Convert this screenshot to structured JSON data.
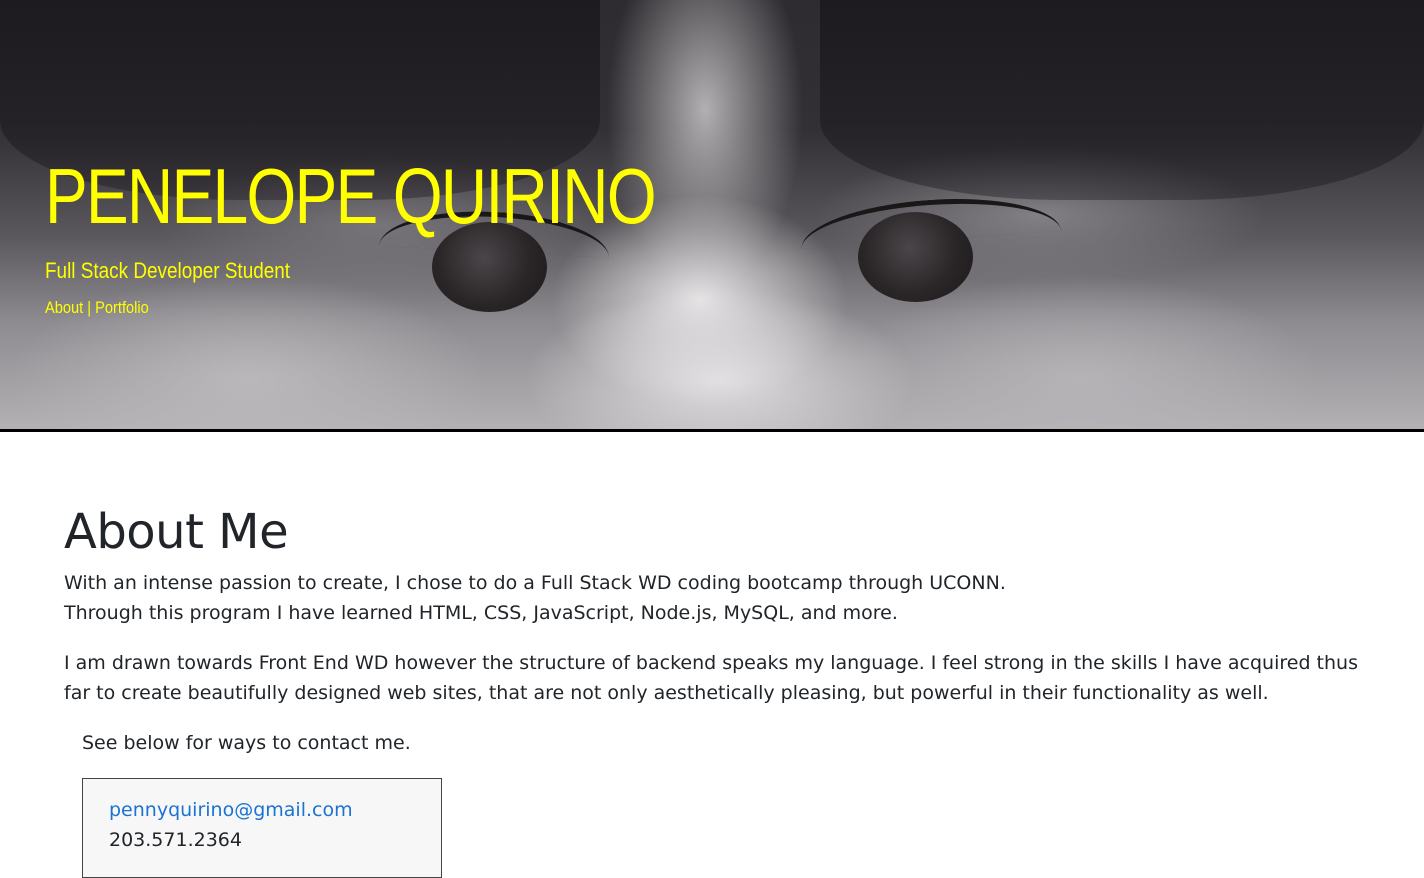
{
  "hero": {
    "title": "PENELOPE QUIRINO",
    "subtitle": "Full Stack Developer Student",
    "nav": {
      "about_label": "About",
      "separator": " | ",
      "portfolio_label": "Portfolio"
    },
    "accent_color": "#ffff00"
  },
  "about": {
    "heading": "About Me",
    "para1_line1": "With an intense passion to create, I chose to do a Full Stack WD coding bootcamp through UCONN.",
    "para1_line2": "Through this program I have learned HTML, CSS, JavaScript, Node.js, MySQL, and more.",
    "para2": "I am drawn towards Front End WD however the structure of backend speaks my language. I feel strong in the skills I have acquired thus far to create beautifully designed web sites, that are not only aesthetically pleasing, but powerful in their functionality as well.",
    "contact_intro": "See below for ways to contact me."
  },
  "contact": {
    "email": "pennyquirino@gmail.com",
    "phone": "203.571.2364",
    "link_color": "#1a73d1"
  }
}
